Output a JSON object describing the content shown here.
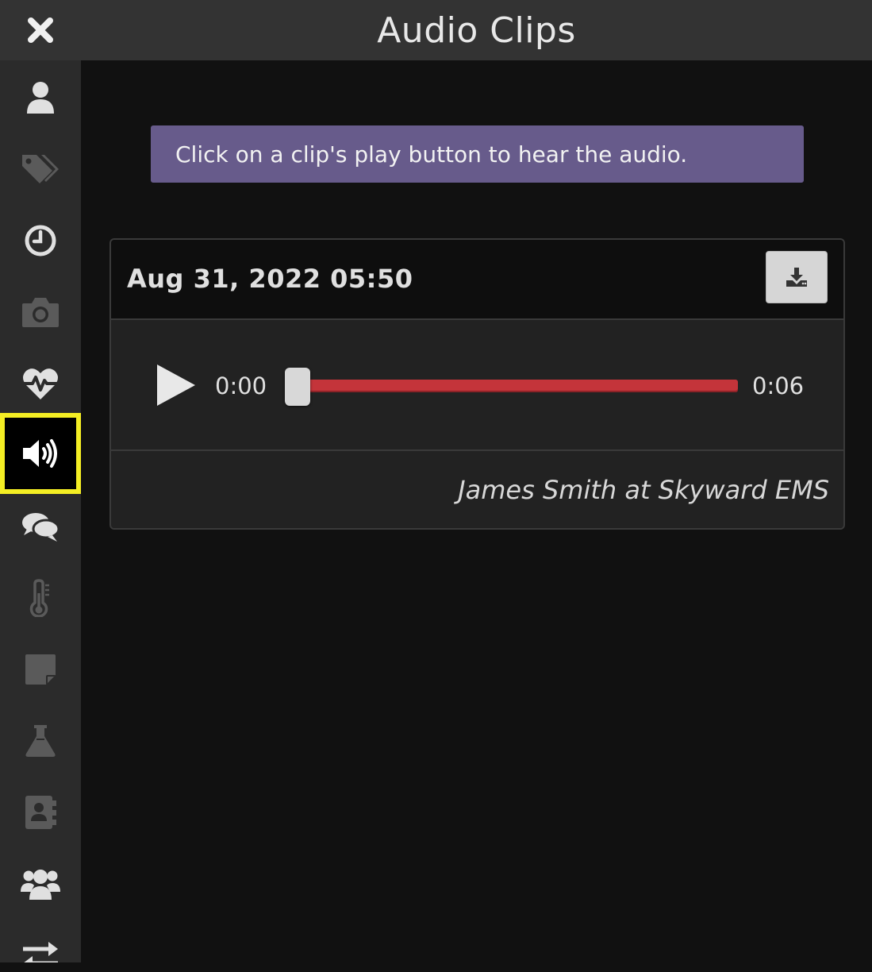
{
  "header": {
    "title": "Audio Clips",
    "close_icon": "close-icon"
  },
  "sidebar": {
    "items": [
      {
        "name": "patient",
        "icon": "user-icon",
        "active": false
      },
      {
        "name": "tags",
        "icon": "tags-icon",
        "active": false
      },
      {
        "name": "history",
        "icon": "clock-icon",
        "active": false
      },
      {
        "name": "photos",
        "icon": "camera-icon",
        "active": false
      },
      {
        "name": "vitals",
        "icon": "heartbeat-icon",
        "active": false
      },
      {
        "name": "audio",
        "icon": "volume-icon",
        "active": true
      },
      {
        "name": "chat",
        "icon": "comments-icon",
        "active": false
      },
      {
        "name": "temperature",
        "icon": "thermometer-icon",
        "active": false
      },
      {
        "name": "notes",
        "icon": "sticky-note-icon",
        "active": false
      },
      {
        "name": "labs",
        "icon": "flask-icon",
        "active": false
      },
      {
        "name": "contacts",
        "icon": "address-book-icon",
        "active": false
      },
      {
        "name": "team",
        "icon": "users-icon",
        "active": false
      },
      {
        "name": "transfer",
        "icon": "exchange-icon",
        "active": false
      }
    ]
  },
  "banner": {
    "text": "Click on a clip's play button to hear the audio."
  },
  "clips": [
    {
      "date": "Aug 31, 2022 05:50",
      "download_icon": "download-icon",
      "time_current": "0:00",
      "time_total": "0:06",
      "progress": 0,
      "author": "James Smith at Skyward EMS"
    }
  ],
  "colors": {
    "accent_banner": "#675b8b",
    "active_highlight": "#f4ee24",
    "seek_bar": "#c4343a"
  }
}
